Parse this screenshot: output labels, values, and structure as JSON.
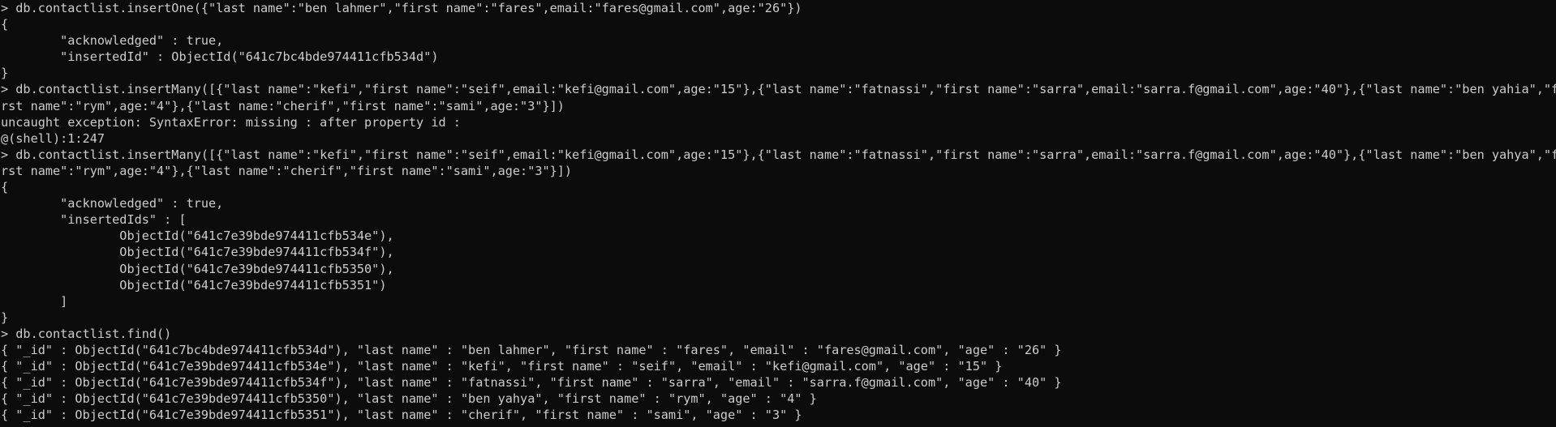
{
  "terminal": {
    "lines": [
      "> db.contactlist.insertOne({\"last name\":\"ben lahmer\",\"first name\":\"fares\",email:\"fares@gmail.com\",age:\"26\"})",
      "{",
      "        \"acknowledged\" : true,",
      "        \"insertedId\" : ObjectId(\"641c7bc4bde974411cfb534d\")",
      "}",
      "> db.contactlist.insertMany([{\"last name\":\"kefi\",\"first name\":\"seif\",email:\"kefi@gmail.com\",age:\"15\"},{\"last name\":\"fatnassi\",\"first name\":\"sarra\",email:\"sarra.f@gmail.com\",age:\"40\"},{\"last name\":\"ben yahia\",\"fi",
      "rst name\":\"rym\",age:\"4\"},{\"last name:\"cherif\",\"first name\":\"sami\",age:\"3\"}])",
      "uncaught exception: SyntaxError: missing : after property id :",
      "@(shell):1:247",
      "> db.contactlist.insertMany([{\"last name\":\"kefi\",\"first name\":\"seif\",email:\"kefi@gmail.com\",age:\"15\"},{\"last name\":\"fatnassi\",\"first name\":\"sarra\",email:\"sarra.f@gmail.com\",age:\"40\"},{\"last name\":\"ben yahya\",\"fi",
      "rst name\":\"rym\",age:\"4\"},{\"last name\":\"cherif\",\"first name\":\"sami\",age:\"3\"}])",
      "{",
      "        \"acknowledged\" : true,",
      "        \"insertedIds\" : [",
      "                ObjectId(\"641c7e39bde974411cfb534e\"),",
      "                ObjectId(\"641c7e39bde974411cfb534f\"),",
      "                ObjectId(\"641c7e39bde974411cfb5350\"),",
      "                ObjectId(\"641c7e39bde974411cfb5351\")",
      "        ]",
      "}",
      "> db.contactlist.find()",
      "{ \"_id\" : ObjectId(\"641c7bc4bde974411cfb534d\"), \"last name\" : \"ben lahmer\", \"first name\" : \"fares\", \"email\" : \"fares@gmail.com\", \"age\" : \"26\" }",
      "{ \"_id\" : ObjectId(\"641c7e39bde974411cfb534e\"), \"last name\" : \"kefi\", \"first name\" : \"seif\", \"email\" : \"kefi@gmail.com\", \"age\" : \"15\" }",
      "{ \"_id\" : ObjectId(\"641c7e39bde974411cfb534f\"), \"last name\" : \"fatnassi\", \"first name\" : \"sarra\", \"email\" : \"sarra.f@gmail.com\", \"age\" : \"40\" }",
      "{ \"_id\" : ObjectId(\"641c7e39bde974411cfb5350\"), \"last name\" : \"ben yahya\", \"first name\" : \"rym\", \"age\" : \"4\" }",
      "{ \"_id\" : ObjectId(\"641c7e39bde974411cfb5351\"), \"last name\" : \"cherif\", \"first name\" : \"sami\", \"age\" : \"3\" }",
      ""
    ]
  }
}
